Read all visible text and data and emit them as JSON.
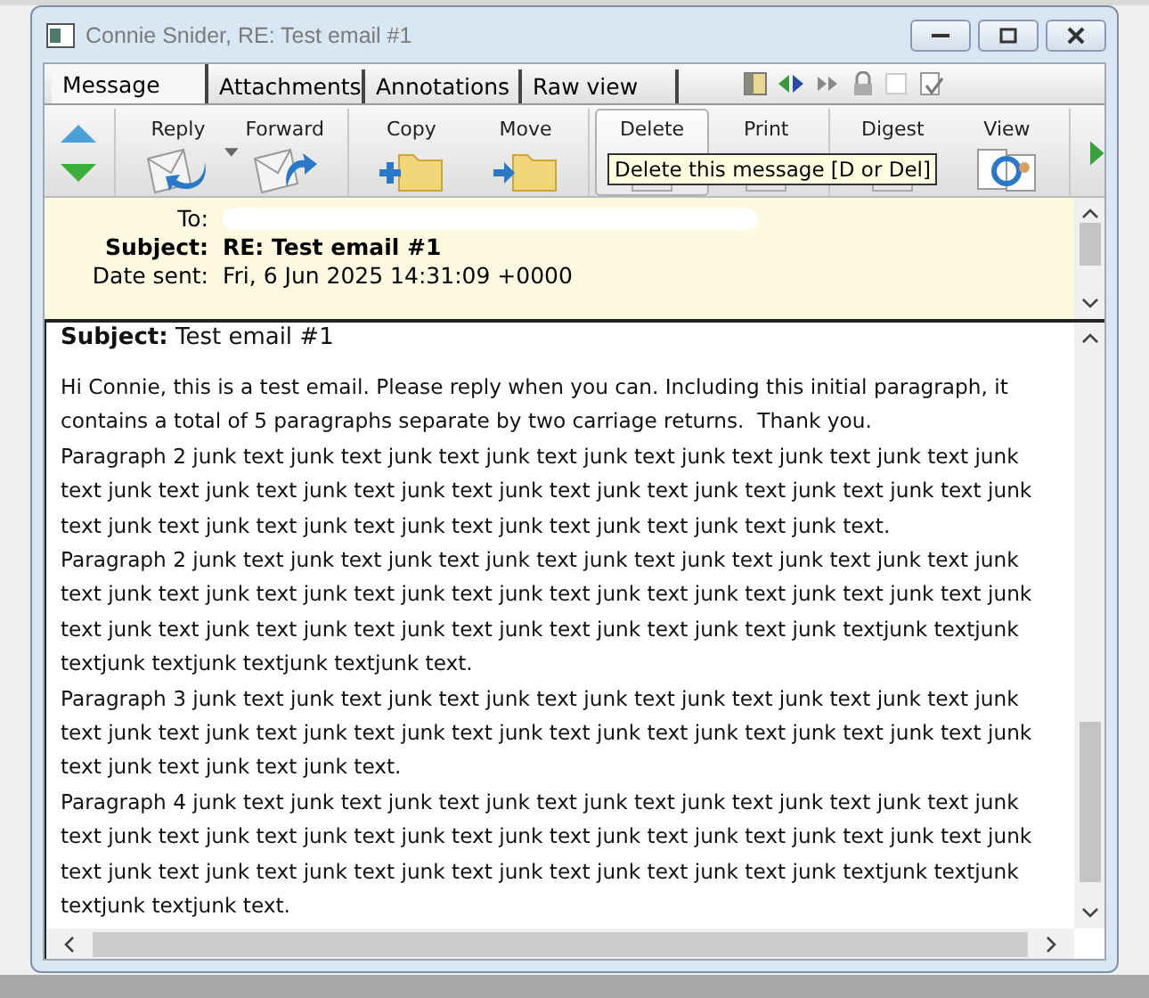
{
  "window": {
    "title": "Connie Snider, RE: Test email #1"
  },
  "tabs": [
    {
      "label": "Message",
      "selected": true
    },
    {
      "label": "Attachments",
      "selected": false
    },
    {
      "label": "Annotations",
      "selected": false
    },
    {
      "label": "Raw view",
      "selected": false
    }
  ],
  "toolbar": [
    {
      "kind": "nav"
    },
    {
      "kind": "reply",
      "label": "Reply",
      "dropdown": true,
      "hovered": false
    },
    {
      "kind": "forward",
      "label": "Forward",
      "dropdown": false,
      "hovered": false
    },
    {
      "kind": "copy",
      "label": "Copy",
      "dropdown": false,
      "hovered": false
    },
    {
      "kind": "move",
      "label": "Move",
      "dropdown": false,
      "hovered": false
    },
    {
      "kind": "delete",
      "label": "Delete",
      "dropdown": false,
      "hovered": true
    },
    {
      "kind": "print",
      "label": "Print",
      "dropdown": false,
      "hovered": false
    },
    {
      "kind": "digest",
      "label": "Digest",
      "dropdown": false,
      "hovered": false
    },
    {
      "kind": "view",
      "label": "View",
      "dropdown": false,
      "hovered": false
    }
  ],
  "tooltip": {
    "text": "Delete this message [D or Del]"
  },
  "header": [
    {
      "label": "To:",
      "redacted": true,
      "bold": false
    },
    {
      "label": "Subject:",
      "value": "RE: Test email #1",
      "redacted": false,
      "bold": true
    },
    {
      "label": "Date sent:",
      "value": "Fri, 6 Jun 2025 14:31:09 +0000",
      "redacted": false,
      "bold": false
    }
  ],
  "body": {
    "heading": "**Subject:** Test email #1",
    "paragraphs": [
      "Hi Connie, this is a test email. Please reply when you can. Including this initial paragraph, it contains a total of 5 paragraphs separate by two carriage returns.  Thank you.",
      "Paragraph 2 junk text junk text junk text junk text junk text junk text junk text junk text junk text junk text junk text junk text junk text junk text junk text junk text junk text junk text junk text junk text junk text junk text junk text junk text junk text junk text junk text.",
      "Paragraph 2 junk text junk text junk text junk text junk text junk text junk text junk text junk text junk text junk text junk text junk text junk text junk text junk text junk text junk text junk text junk text junk text junk text junk text junk text junk text junk text junk textjunk textjunk textjunk textjunk textjunk textjunk text.",
      "Paragraph 3 junk text junk text junk text junk text junk text junk text junk text junk text junk text junk text junk text junk text junk text junk text junk text junk text junk text junk text junk text junk text junk text junk text.",
      "Paragraph 4 junk text junk text junk text junk text junk text junk text junk text junk text junk text junk text junk text junk text junk text junk text junk text junk text junk text junk text junk text junk text junk text junk text junk text junk text junk text junk text junk textjunk textjunk textjunk textjunk text."
    ]
  }
}
